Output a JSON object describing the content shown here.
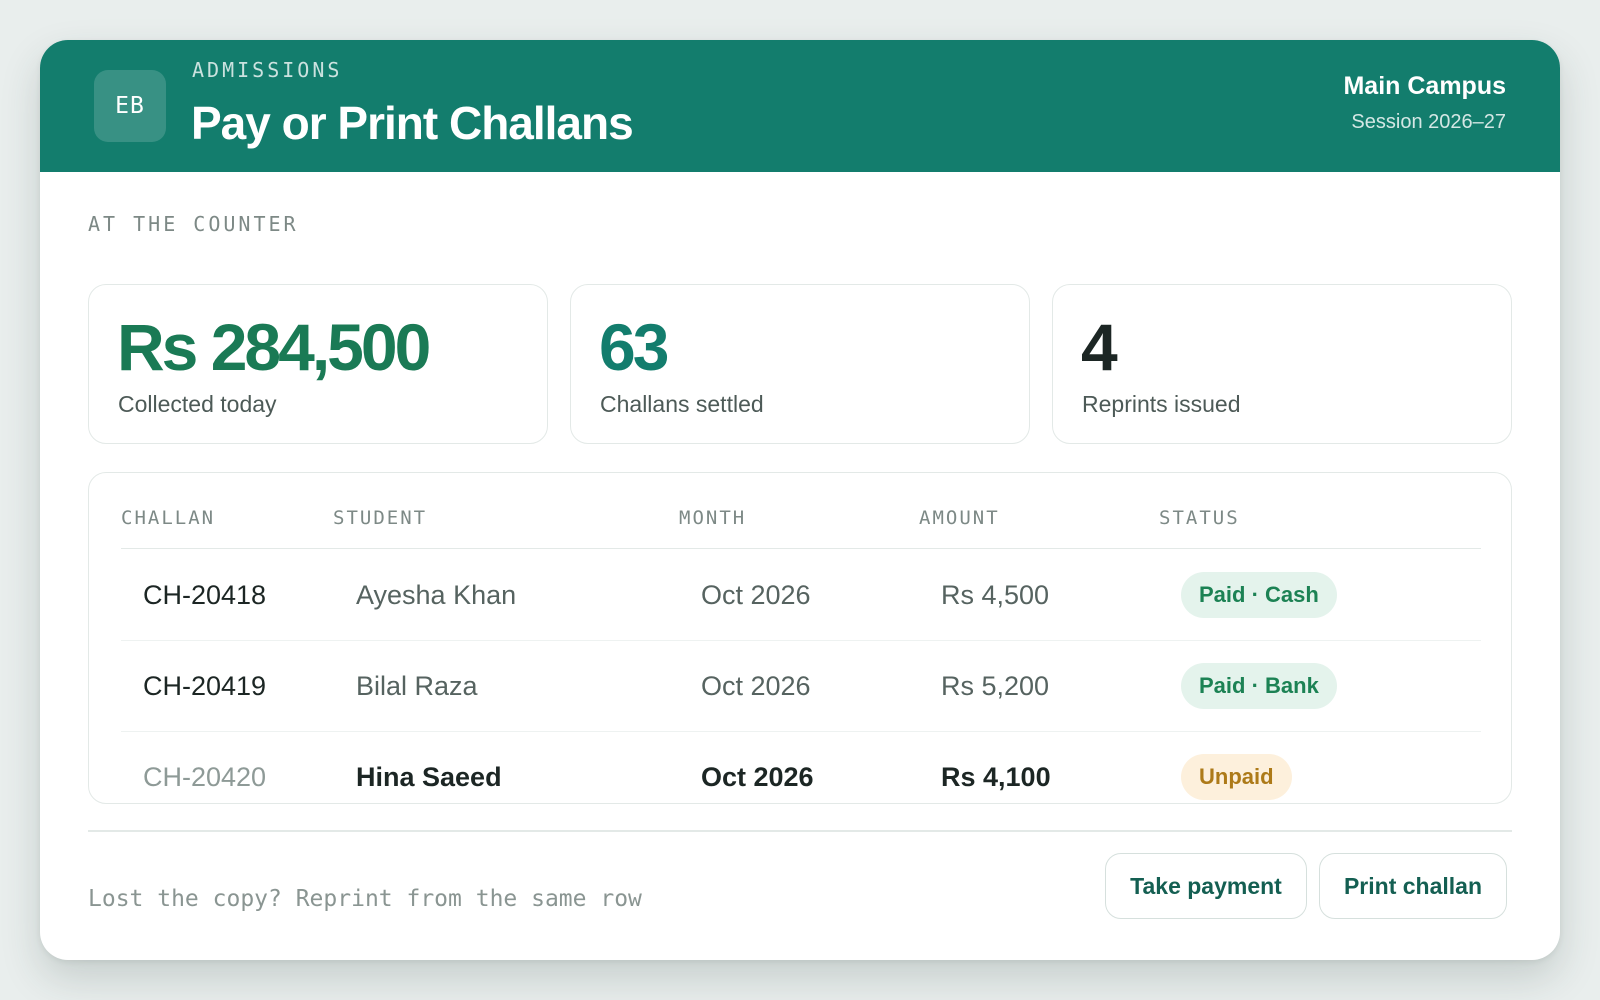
{
  "header": {
    "logo_initials": "EB",
    "eyebrow": "ADMISSIONS",
    "title": "Pay or Print Challans",
    "campus": "Main Campus",
    "session": "Session 2026–27"
  },
  "section_label": "AT THE COUNTER",
  "stats": [
    {
      "value": "Rs 284,500",
      "label": "Collected today",
      "color": "#1a7a55"
    },
    {
      "value": "63",
      "label": "Challans settled",
      "color": "#137d6d"
    },
    {
      "value": "4",
      "label": "Reprints issued",
      "color": "#1c2624"
    }
  ],
  "table": {
    "columns": [
      "CHALLAN",
      "STUDENT",
      "MONTH",
      "AMOUNT",
      "STATUS"
    ],
    "rows": [
      {
        "challan": "CH-20418",
        "student": "Ayesha Khan",
        "month": "Oct 2026",
        "amount": "Rs 4,500",
        "status": "Paid · Cash",
        "status_type": "paid"
      },
      {
        "challan": "CH-20419",
        "student": "Bilal Raza",
        "month": "Oct 2026",
        "amount": "Rs 5,200",
        "status": "Paid · Bank",
        "status_type": "paid"
      },
      {
        "challan": "CH-20420",
        "student": "Hina Saeed",
        "month": "Oct 2026",
        "amount": "Rs 4,100",
        "status": "Unpaid",
        "status_type": "unpaid"
      }
    ]
  },
  "footer": {
    "hint": "Lost the copy? Reprint from the same row",
    "take_payment_label": "Take payment",
    "print_challan_label": "Print challan"
  },
  "colors": {
    "brand": "#137d6d",
    "paid_badge": "#e4f3ec",
    "unpaid_badge": "#fdf0dc"
  }
}
